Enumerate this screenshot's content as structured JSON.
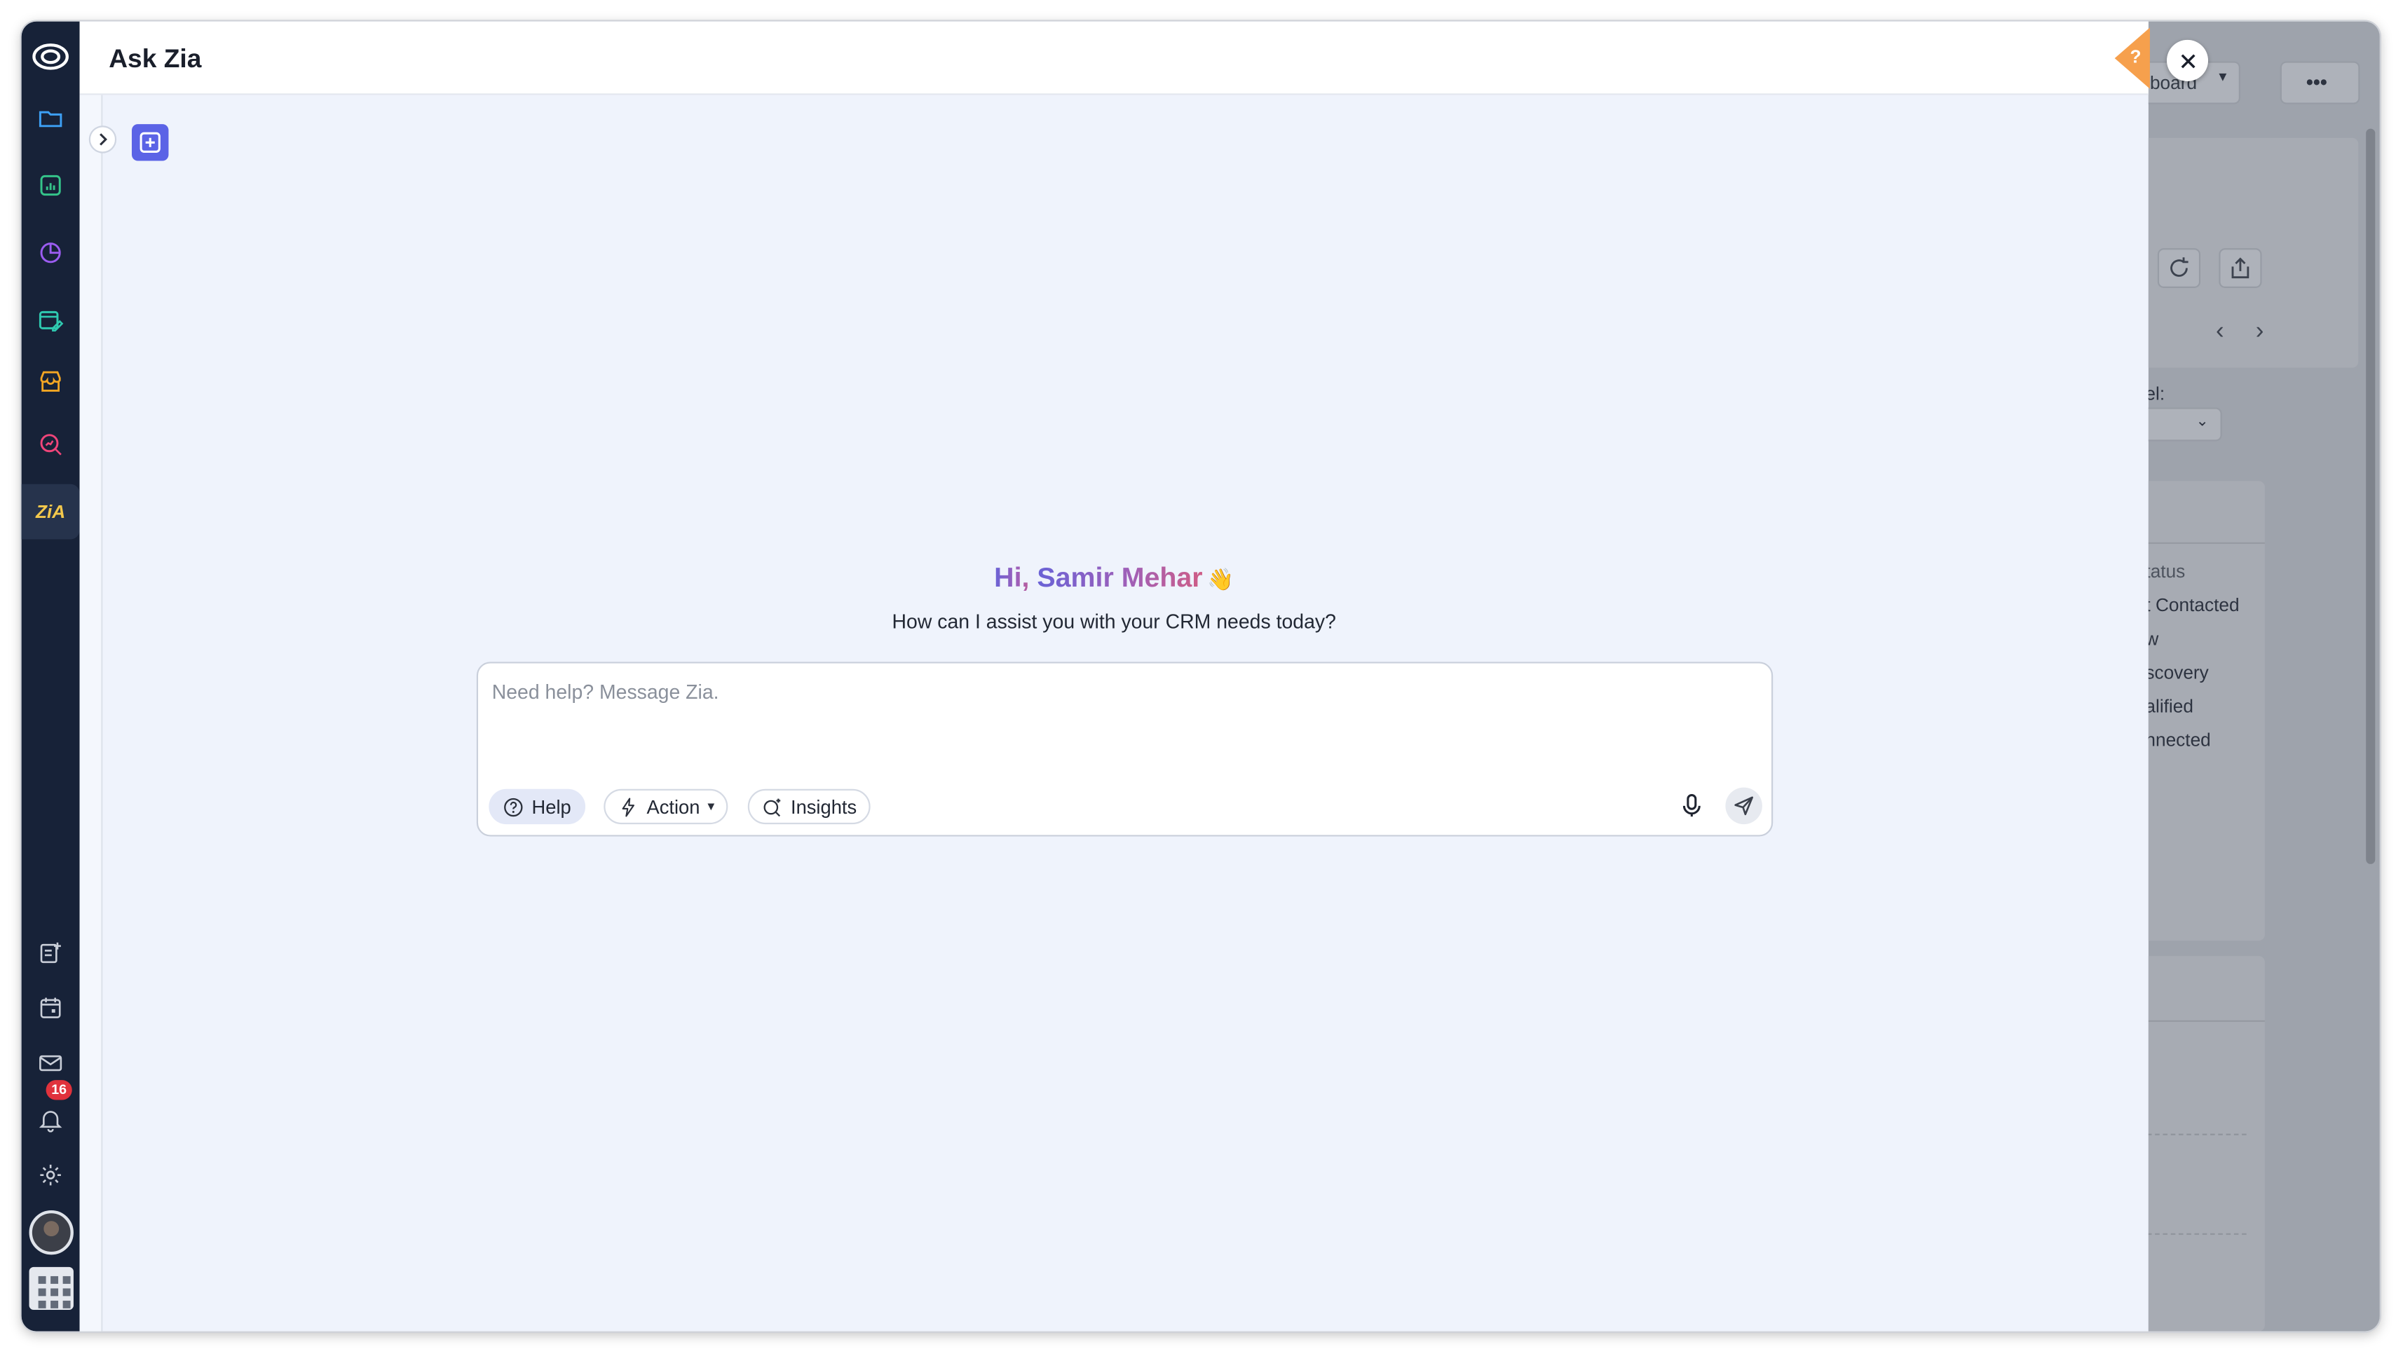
{
  "panel": {
    "title": "Ask Zia",
    "greeting_prefix": "Hi, ",
    "greeting_name": "Samir Mehar",
    "greeting_emoji": "👋",
    "subtitle": "How can I assist you with your CRM needs today?",
    "input_placeholder": "Need help? Message Zia.",
    "chips": [
      {
        "label": "Help",
        "icon": "help-circle-icon",
        "active": true
      },
      {
        "label": "Action",
        "icon": "bolt-icon",
        "dropdown": true
      },
      {
        "label": "Insights",
        "icon": "insights-icon"
      }
    ],
    "help_tab": "?"
  },
  "sidebar": {
    "top_icons": [
      "zoho-crm-logo",
      "folder-icon",
      "analytics-icon",
      "pie-chart-icon",
      "calendar-edit-icon",
      "store-icon",
      "search-analytics-icon",
      "zia-icon"
    ],
    "bottom_icons": [
      "add-note-icon",
      "calendar-icon",
      "mail-icon",
      "bell-icon",
      "gear-icon",
      "avatar",
      "apps-grid-icon"
    ],
    "notification_count": "16"
  },
  "background": {
    "dropdown_partial": "board",
    "more_label": "•••",
    "filter_label_partial": "el:",
    "status_header_partial": "tatus",
    "status_items_partial": [
      "t Contacted",
      "w",
      "scovery",
      "alified",
      "nnected"
    ]
  },
  "colors": {
    "rail": "#172238",
    "panel_bg": "#eff3fc",
    "accent": "#5b63e6",
    "badge": "#e0323c",
    "help_tab": "#f6a04d"
  }
}
